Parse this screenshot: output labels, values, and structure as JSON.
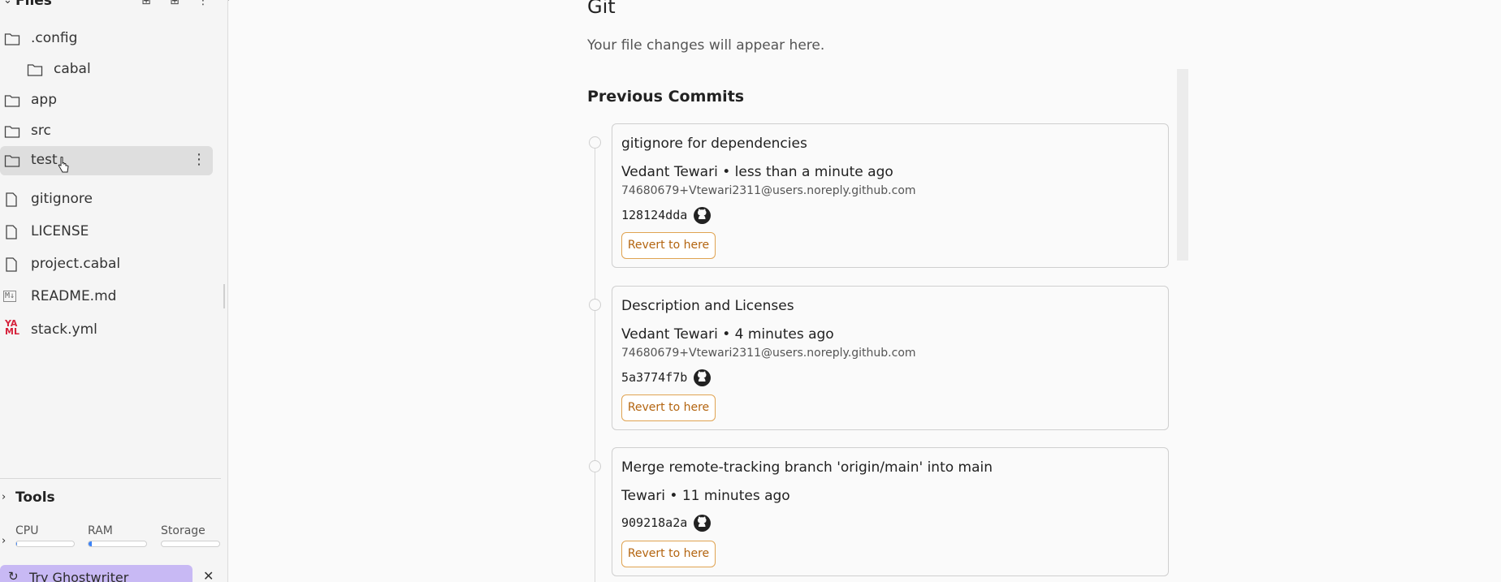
{
  "sidebar": {
    "files_title": "Files",
    "tree": [
      {
        "label": ".config",
        "type": "folder"
      },
      {
        "label": "cabal",
        "type": "folder"
      },
      {
        "label": "app",
        "type": "folder"
      },
      {
        "label": "src",
        "type": "folder"
      },
      {
        "label": "test",
        "type": "folder",
        "selected": true
      },
      {
        "label": "gitignore",
        "type": "file"
      },
      {
        "label": "LICENSE",
        "type": "file"
      },
      {
        "label": "project.cabal",
        "type": "file"
      },
      {
        "label": "README.md",
        "type": "markdown"
      },
      {
        "label": "stack.yml",
        "type": "yaml"
      }
    ],
    "tools_label": "Tools",
    "resources": [
      {
        "label": "CPU",
        "fill": 0.02
      },
      {
        "label": "RAM",
        "fill": 0.05
      },
      {
        "label": "Storage",
        "fill": 0.0
      }
    ],
    "ghostwriter_label": "Try Ghostwriter",
    "close_glyph": "✕"
  },
  "main": {
    "title": "Git",
    "subtitle": "Your file changes will appear here.",
    "previous_commits_title": "Previous Commits",
    "revert_label": "Revert to here",
    "commits": [
      {
        "message": "gitignore for dependencies",
        "author_line": "Vedant Tewari • less than a minute ago",
        "email": "74680679+Vtewari2311@users.noreply.github.com",
        "hash": "128124dda"
      },
      {
        "message": "Description and Licenses",
        "author_line": "Vedant Tewari • 4 minutes ago",
        "email": "74680679+Vtewari2311@users.noreply.github.com",
        "hash": "5a3774f7b"
      },
      {
        "message": "Merge remote-tracking branch 'origin/main' into main",
        "author_line": "Tewari • 11 minutes ago",
        "email": "",
        "hash": "909218a2a"
      }
    ]
  },
  "colors": {
    "accent_orange": "#e0a351",
    "ghostwriter_bg": "#c8b9f4",
    "progress_blue": "#3b82f6"
  }
}
